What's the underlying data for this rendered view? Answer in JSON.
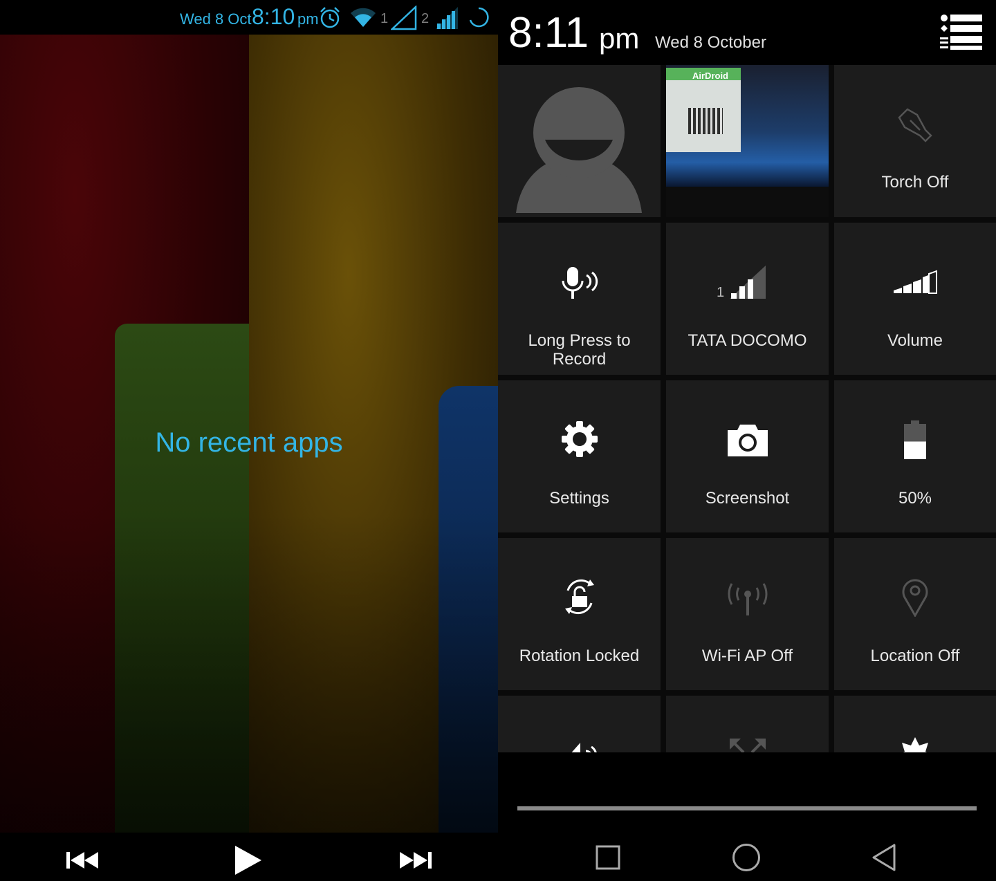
{
  "left_pane": {
    "status_bar": {
      "date": "Wed 8 Oct",
      "time": "8:10",
      "ampm": "pm",
      "sim1_label": "1",
      "sim2_label": "2",
      "icons": [
        "alarm-icon",
        "wifi-icon",
        "sim1-signal-icon",
        "sim2-signal-icon",
        "sync-icon"
      ],
      "color": "#33b5e5"
    },
    "recent_apps": {
      "empty_message": "No recent apps"
    },
    "media_controls": {
      "icons": [
        "previous-track-icon",
        "play-icon",
        "next-track-icon"
      ]
    }
  },
  "right_pane": {
    "header": {
      "time": "8:11",
      "ampm": "pm",
      "date": "Wed 8 October",
      "menu_icon": "list-settings-icon"
    },
    "quick_settings": {
      "tiles": [
        {
          "label": "",
          "icon": "user-avatar-icon"
        },
        {
          "label": "",
          "icon": "screenshot-thumbnail",
          "thumbnail_text": "AirDroid"
        },
        {
          "label": "Torch Off",
          "icon": "torch-icon"
        },
        {
          "label": "Long Press to Record",
          "label_line1": "Long Press to",
          "label_line2": "Record",
          "icon": "microphone-icon"
        },
        {
          "label": "TATA DOCOMO",
          "icon": "signal-icon",
          "sim_label": "1"
        },
        {
          "label": "Volume",
          "icon": "volume-icon"
        },
        {
          "label": "Settings",
          "icon": "gear-icon"
        },
        {
          "label": "Screenshot",
          "icon": "camera-icon"
        },
        {
          "label": "50%",
          "icon": "battery-icon",
          "battery_level": 0.5
        },
        {
          "label": "Rotation Locked",
          "icon": "rotation-lock-icon"
        },
        {
          "label": "Wi-Fi AP Off",
          "icon": "wifi-ap-icon"
        },
        {
          "label": "Location Off",
          "icon": "location-icon"
        },
        {
          "label": "",
          "icon": "sound-icon"
        },
        {
          "label": "",
          "icon": "expand-icon"
        },
        {
          "label": "",
          "icon": "brightness-icon"
        }
      ]
    },
    "nav_bar": {
      "icons": [
        "recents-icon",
        "home-icon",
        "back-icon"
      ]
    }
  }
}
